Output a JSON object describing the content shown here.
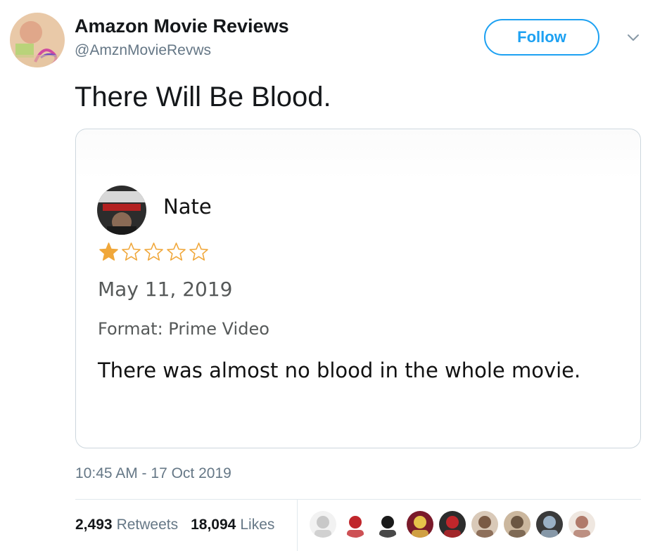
{
  "account": {
    "display_name": "Amazon Movie Reviews",
    "handle": "@AmznMovieRevws",
    "avatar_icon": "account-avatar-image"
  },
  "follow_button": {
    "label": "Follow"
  },
  "menu_caret_icon": "chevron-down-icon",
  "tweet": {
    "text": "There Will Be Blood."
  },
  "review_card": {
    "reviewer_name": "Nate",
    "reviewer_avatar_icon": "reviewer-avatar-image",
    "rating": 1,
    "rating_max": 5,
    "date": "May 11, 2019",
    "format": "Format: Prime Video",
    "body": "There was almost no blood in the whole movie.",
    "star_color": "#f0a73a"
  },
  "timestamp": "10:45 AM - 17 Oct 2019",
  "stats": {
    "retweets_count": "2,493",
    "retweets_label": "Retweets",
    "likes_count": "18,094",
    "likes_label": "Likes"
  },
  "liker_avatars": [
    "liker-avatar-1",
    "liker-avatar-2",
    "liker-avatar-3",
    "liker-avatar-4",
    "liker-avatar-5",
    "liker-avatar-6",
    "liker-avatar-7",
    "liker-avatar-8",
    "liker-avatar-9"
  ],
  "colors": {
    "accent": "#1da1f2",
    "muted": "#657786",
    "text": "#14171a"
  }
}
